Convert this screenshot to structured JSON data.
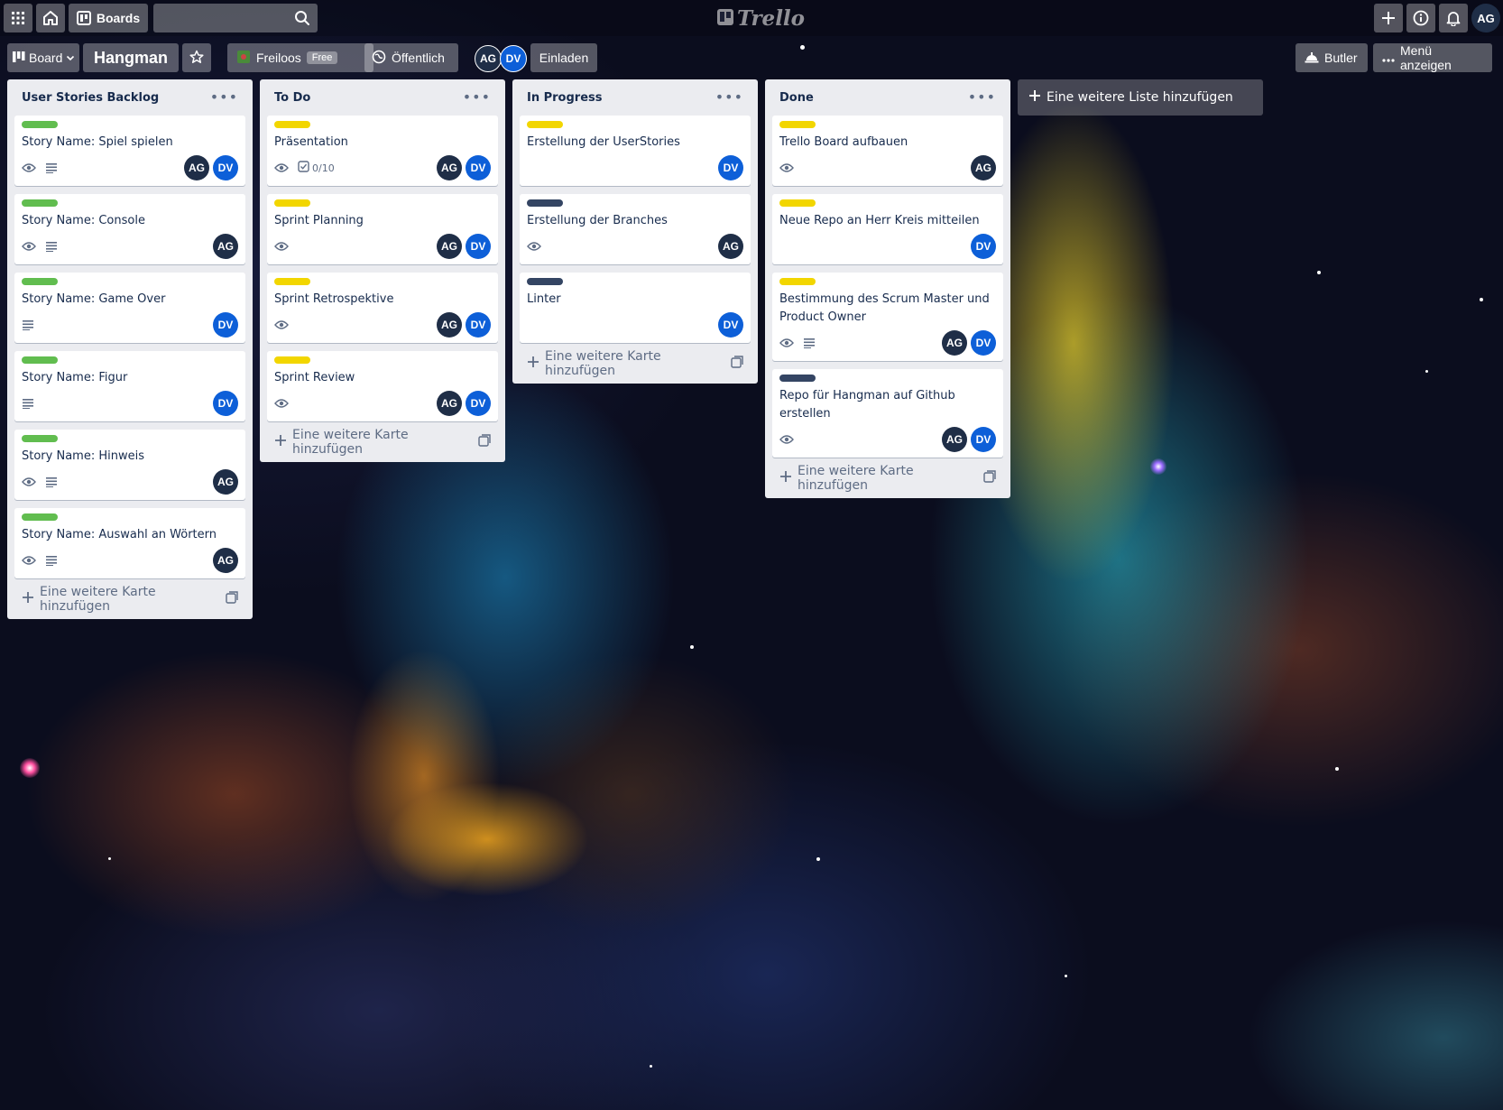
{
  "colors": {
    "label_green": "#61bd4f",
    "label_yellow": "#f2d600",
    "label_navy": "#344563",
    "avatar_ag": "#1f2e47",
    "avatar_dv": "#0d5fd8"
  },
  "topbar": {
    "apps_icon": "grid-icon",
    "home_icon": "home-icon",
    "boards_label": "Boards",
    "search_placeholder": "",
    "search_icon": "search-icon",
    "logo_text": "Trello",
    "user_initials": "AG"
  },
  "board_header": {
    "view_label": "Board",
    "title": "Hangman",
    "workspace": "Freiloos",
    "plan_badge": "Free",
    "visibility": "Öffentlich",
    "members": [
      "AG",
      "DV"
    ],
    "invite_label": "Einladen",
    "butler_label": "Butler",
    "menu_label": "Menü anzeigen"
  },
  "lists": [
    {
      "title": "User Stories Backlog",
      "add_card_label": "Eine weitere Karte hinzufügen",
      "cards": [
        {
          "label": "green",
          "title": "Story Name: Spiel spielen",
          "watch": true,
          "description": true,
          "members": [
            "AG",
            "DV"
          ]
        },
        {
          "label": "green",
          "title": "Story Name: Console",
          "watch": true,
          "description": true,
          "members": [
            "AG"
          ]
        },
        {
          "label": "green",
          "title": "Story Name: Game Over",
          "watch": false,
          "description": true,
          "members": [
            "DV"
          ]
        },
        {
          "label": "green",
          "title": "Story Name: Figur",
          "watch": false,
          "description": true,
          "members": [
            "DV"
          ]
        },
        {
          "label": "green",
          "title": "Story Name: Hinweis",
          "watch": true,
          "description": true,
          "members": [
            "AG"
          ]
        },
        {
          "label": "green",
          "title": "Story Name: Auswahl an Wörtern",
          "watch": true,
          "description": true,
          "members": [
            "AG"
          ]
        }
      ]
    },
    {
      "title": "To Do",
      "add_card_label": "Eine weitere Karte hinzufügen",
      "cards": [
        {
          "label": "yellow",
          "title": "Präsentation",
          "watch": true,
          "checklist": "0/10",
          "members": [
            "AG",
            "DV"
          ]
        },
        {
          "label": "yellow",
          "title": "Sprint Planning",
          "watch": true,
          "members": [
            "AG",
            "DV"
          ]
        },
        {
          "label": "yellow",
          "title": "Sprint Retrospektive",
          "watch": true,
          "members": [
            "AG",
            "DV"
          ]
        },
        {
          "label": "yellow",
          "title": "Sprint Review",
          "watch": true,
          "members": [
            "AG",
            "DV"
          ]
        }
      ]
    },
    {
      "title": "In Progress",
      "add_card_label": "Eine weitere Karte hinzufügen",
      "cards": [
        {
          "label": "yellow",
          "title": "Erstellung der UserStories",
          "members": [
            "DV"
          ]
        },
        {
          "label": "navy",
          "title": "Erstellung der Branches",
          "watch": true,
          "members": [
            "AG"
          ]
        },
        {
          "label": "navy",
          "title": "Linter",
          "members": [
            "DV"
          ]
        }
      ]
    },
    {
      "title": "Done",
      "add_card_label": "Eine weitere Karte hinzufügen",
      "cards": [
        {
          "label": "yellow",
          "title": "Trello Board aufbauen",
          "watch": true,
          "members": [
            "AG"
          ]
        },
        {
          "label": "yellow",
          "title": "Neue Repo an Herr Kreis mitteilen",
          "members": [
            "DV"
          ]
        },
        {
          "label": "yellow",
          "title": "Bestimmung des Scrum Master und Product Owner",
          "watch": true,
          "description": true,
          "members": [
            "AG",
            "DV"
          ]
        },
        {
          "label": "navy",
          "title": "Repo für Hangman auf Github erstellen",
          "watch": true,
          "members": [
            "AG",
            "DV"
          ]
        }
      ]
    }
  ],
  "add_list_label": "Eine weitere Liste hinzufügen"
}
